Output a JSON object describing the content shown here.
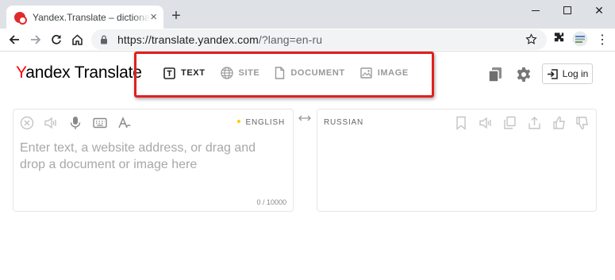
{
  "browser": {
    "tab_title": "Yandex.Translate – dictionary a",
    "tab_close": "×",
    "new_tab": "+",
    "url_main": "https://translate.yandex.com",
    "url_rest": "/?lang=en-ru",
    "window_close": "✕",
    "menu": "⋮"
  },
  "header": {
    "logo_y": "Y",
    "logo_rest": "andex Translate",
    "modes": [
      {
        "label": "TEXT",
        "icon": "text-icon"
      },
      {
        "label": "SITE",
        "icon": "globe-icon"
      },
      {
        "label": "DOCUMENT",
        "icon": "document-icon"
      },
      {
        "label": "IMAGE",
        "icon": "image-icon"
      }
    ],
    "login_label": "Log in"
  },
  "source": {
    "language": "ENGLISH",
    "placeholder": "Enter text, a website address, or drag and drop a document or image here",
    "counter": "0 / 10000"
  },
  "target": {
    "language": "RUSSIAN"
  },
  "colors": {
    "brand_red": "#ff0000",
    "highlight": "#e02020",
    "active_mode": "#222222",
    "inactive_mode": "#999999"
  }
}
